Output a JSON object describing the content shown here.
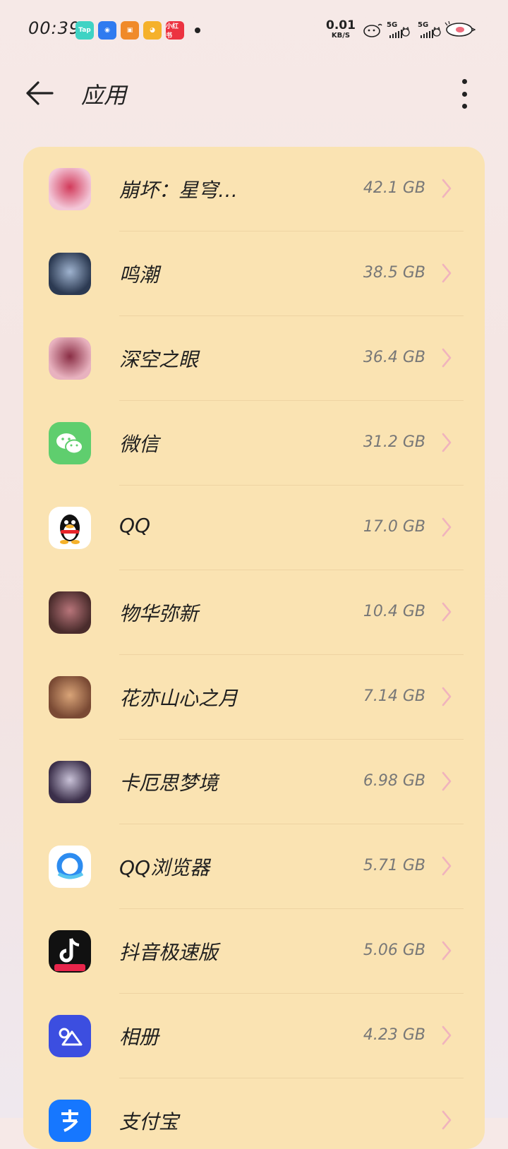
{
  "status_bar": {
    "time": "00:39",
    "notifications": [
      {
        "label": "Tap",
        "color": "#3fd3c4"
      },
      {
        "label": "◉",
        "color": "#2f7bf0"
      },
      {
        "label": "▣",
        "color": "#f08a2a"
      },
      {
        "label": "◕",
        "color": "#f5b12a"
      },
      {
        "label": "小红书",
        "color": "#ec3341"
      }
    ],
    "net_speed_value": "0.01",
    "net_speed_unit": "KB/S",
    "sim1_label": "5G",
    "sim2_label": "5G"
  },
  "header": {
    "title": "应用"
  },
  "apps": [
    {
      "name": "崩坏：星穹…",
      "size": "42.1 GB",
      "icon": "honkai-star-rail-icon",
      "colors": [
        "#f3c7d8",
        "#d23b5b"
      ]
    },
    {
      "name": "鸣潮",
      "size": "38.5 GB",
      "icon": "wuthering-waves-icon",
      "colors": [
        "#2c3a52",
        "#9fb3cf"
      ]
    },
    {
      "name": "深空之眼",
      "size": "36.4 GB",
      "icon": "aether-gazer-icon",
      "colors": [
        "#e8b2bf",
        "#8a2e45"
      ]
    },
    {
      "name": "微信",
      "size": "31.2 GB",
      "icon": "wechat-icon",
      "colors": [
        "#5fce6e",
        "#ffffff"
      ]
    },
    {
      "name": "QQ",
      "size": "17.0 GB",
      "icon": "qq-icon",
      "colors": [
        "#ffffff",
        "#111111"
      ]
    },
    {
      "name": "物华弥新",
      "size": "10.4 GB",
      "icon": "wuhua-mixin-icon",
      "colors": [
        "#4a2c2c",
        "#b8757a"
      ]
    },
    {
      "name": "花亦山心之月",
      "size": "7.14 GB",
      "icon": "huayi-shanxin-icon",
      "colors": [
        "#7a4a34",
        "#d9a478"
      ]
    },
    {
      "name": "卡厄思梦境",
      "size": "6.98 GB",
      "icon": "chaos-dream-icon",
      "colors": [
        "#3b2f4a",
        "#c9c2d8"
      ]
    },
    {
      "name": "QQ浏览器",
      "size": "5.71 GB",
      "icon": "qq-browser-icon",
      "colors": [
        "#ffffff",
        "#2d8cf0"
      ]
    },
    {
      "name": "抖音极速版",
      "size": "5.06 GB",
      "icon": "douyin-lite-icon",
      "colors": [
        "#111111",
        "#e8254b"
      ]
    },
    {
      "name": "相册",
      "size": "4.23 GB",
      "icon": "gallery-icon",
      "colors": [
        "#3c4ee0",
        "#ffffff"
      ]
    },
    {
      "name": "支付宝",
      "size": "",
      "icon": "alipay-icon",
      "colors": [
        "#1677ff",
        "#ffffff"
      ]
    }
  ],
  "colors": {
    "card_background": "#fae3b2",
    "chevron": "#f0b3bd",
    "page_background": "#f6e9e7"
  }
}
